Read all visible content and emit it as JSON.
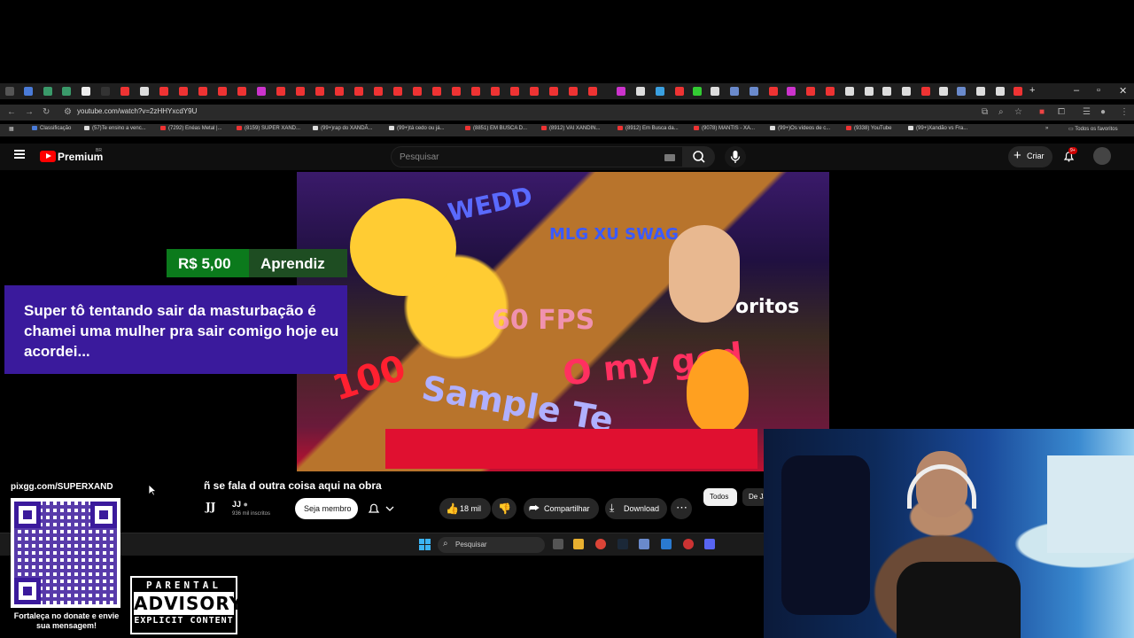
{
  "browser": {
    "url": "youtube.com/watch?v=2zHHYxcdY9U",
    "bookmarks": [
      "Classificação",
      "(57)Te ensino a venc...",
      "(7292) Enéas Metal |...",
      "(8159) SUPER XAND...",
      "(99+)rap do XANDÃ...",
      "(99+)tá cedo ou já...",
      "(8851) EM BUSCA D...",
      "(8912) VAI XANDIN...",
      "(8912) Em Busca da...",
      "(9078) MANTIS - XA...",
      "(99+)Os vídeos de c...",
      "(9338) YouTube",
      "(99+)Xandão vs Fra..."
    ],
    "all_bookmarks": "Todos os favoritos"
  },
  "youtube": {
    "brand": "Premium",
    "region": "BR",
    "search_placeholder": "Pesquisar",
    "create_label": "Criar",
    "notif_count": "9+",
    "video_title": "ñ se fala d outra coisa aqui na obra",
    "channel_logo": "JJ",
    "channel_name": "JJ",
    "channel_subs": "936 mil inscritos",
    "join_label": "Seja membro",
    "likes": "18 mil",
    "share_label": "Compartilhar",
    "download_label": "Download",
    "chips": [
      "Todos",
      "De JJ"
    ]
  },
  "video_overlay_text": {
    "line1": "WEDD",
    "line2": "MLG XU SWAG",
    "line3": "60 FPS",
    "line4": "oritos",
    "line5": "O my god",
    "line6": "Sample Te",
    "line7": "100"
  },
  "donation": {
    "amount": "R$ 5,00",
    "user": "Aprendiz",
    "message": "Super tô tentando sair da masturbação é chamei uma mulher pra sair comigo hoje eu acordei..."
  },
  "taskbar": {
    "search_label": "Pesquisar"
  },
  "pix": {
    "url": "pixgg.com/SUPERXAND",
    "caption": "Fortaleça no donate e envie sua mensagem!"
  },
  "parental_advisory": {
    "top": "PARENTAL",
    "middle": "ADVISORY",
    "bottom": "EXPLICIT CONTENT"
  },
  "colors": {
    "yt_red": "#ff0000",
    "donation_green": "#0b7a1c",
    "donation_purple": "#3a1a9c"
  }
}
